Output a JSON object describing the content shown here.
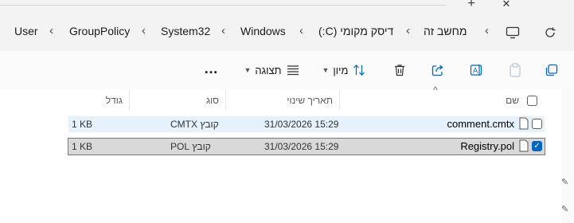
{
  "window": {
    "new_tab_glyph": "+",
    "close_glyph": "✕"
  },
  "address": {
    "breadcrumbs": [
      "מחשב זה",
      "דיסק מקומי (C:)",
      "Windows",
      "System32",
      "GroupPolicy",
      "User"
    ],
    "separator": "‹",
    "refresh_icon": "refresh-icon",
    "view_icon": "monitor-icon"
  },
  "toolbar": {
    "more": "…",
    "view_label": "תצוגה",
    "sort_label": "מיון",
    "icons": [
      "new-item-icon",
      "copy-icon",
      "paste-icon",
      "rename-icon",
      "share-icon",
      "delete-icon",
      "sort-icon",
      "view-icon",
      "more-icon"
    ]
  },
  "columns": {
    "name": "שם",
    "date": "תאריך שינוי",
    "type": "סוג",
    "size": "גודל",
    "sort_caret": "^"
  },
  "files": [
    {
      "name": "comment.cmtx",
      "date": "31/03/2026 15:29",
      "type": "קובץ CMTX",
      "size": "1 KB",
      "selected": false
    },
    {
      "name": "Registry.pol",
      "date": "31/03/2026 15:29",
      "type": "קובץ POL",
      "size": "1 KB",
      "selected": true
    }
  ],
  "colors": {
    "accent": "#0067c0",
    "hover_row": "#e5f1fb",
    "selected_row": "#d9d9d9"
  }
}
